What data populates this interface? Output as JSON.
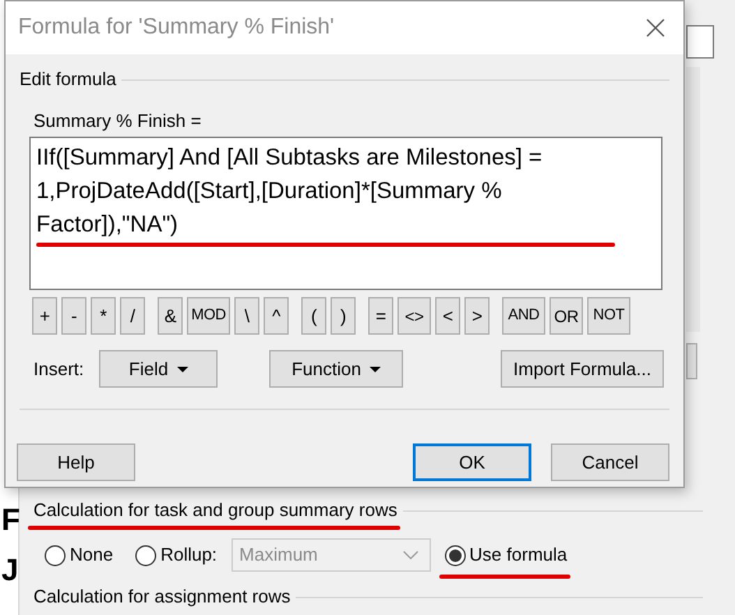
{
  "dialog": {
    "title": "Formula for 'Summary % Finish'",
    "group_label": "Edit formula",
    "field_label": "Summary % Finish =",
    "formula": {
      "value": "IIf([Summary] And [All Subtasks are Milestones] = 1,ProjDateAdd([Start],[Duration]*[Summary % Factor]),\"NA\")",
      "underlined": true
    },
    "operator_groups": [
      [
        "+",
        "-",
        "*",
        "/"
      ],
      [
        "&",
        "MOD",
        "\\",
        "^"
      ],
      [
        "(",
        ")"
      ],
      [
        "=",
        "<>",
        "<",
        ">"
      ],
      [
        "AND",
        "OR",
        "NOT"
      ]
    ],
    "insert_label": "Insert:",
    "insert_buttons": [
      {
        "label": "Field",
        "dropdown": true
      },
      {
        "label": "Function",
        "dropdown": true
      }
    ],
    "import_button": "Import Formula...",
    "buttons": [
      {
        "label": "Help",
        "default": false
      },
      {
        "label": "OK",
        "default": true
      },
      {
        "label": "Cancel",
        "default": false
      }
    ]
  },
  "background": {
    "row_letters": [
      "F",
      "J"
    ],
    "summary_section": {
      "heading": "Calculation for task and group summary rows",
      "underlined": true,
      "options": [
        {
          "kind": "radio",
          "label": "None",
          "selected": false,
          "underlined": false
        },
        {
          "kind": "radio",
          "label": "Rollup:",
          "selected": false,
          "underlined": false
        },
        {
          "kind": "dropdown",
          "label": "Maximum",
          "disabled": true
        },
        {
          "kind": "radio",
          "label": "Use formula",
          "selected": true,
          "underlined": true
        }
      ]
    },
    "assignment_heading": "Calculation for assignment rows"
  }
}
